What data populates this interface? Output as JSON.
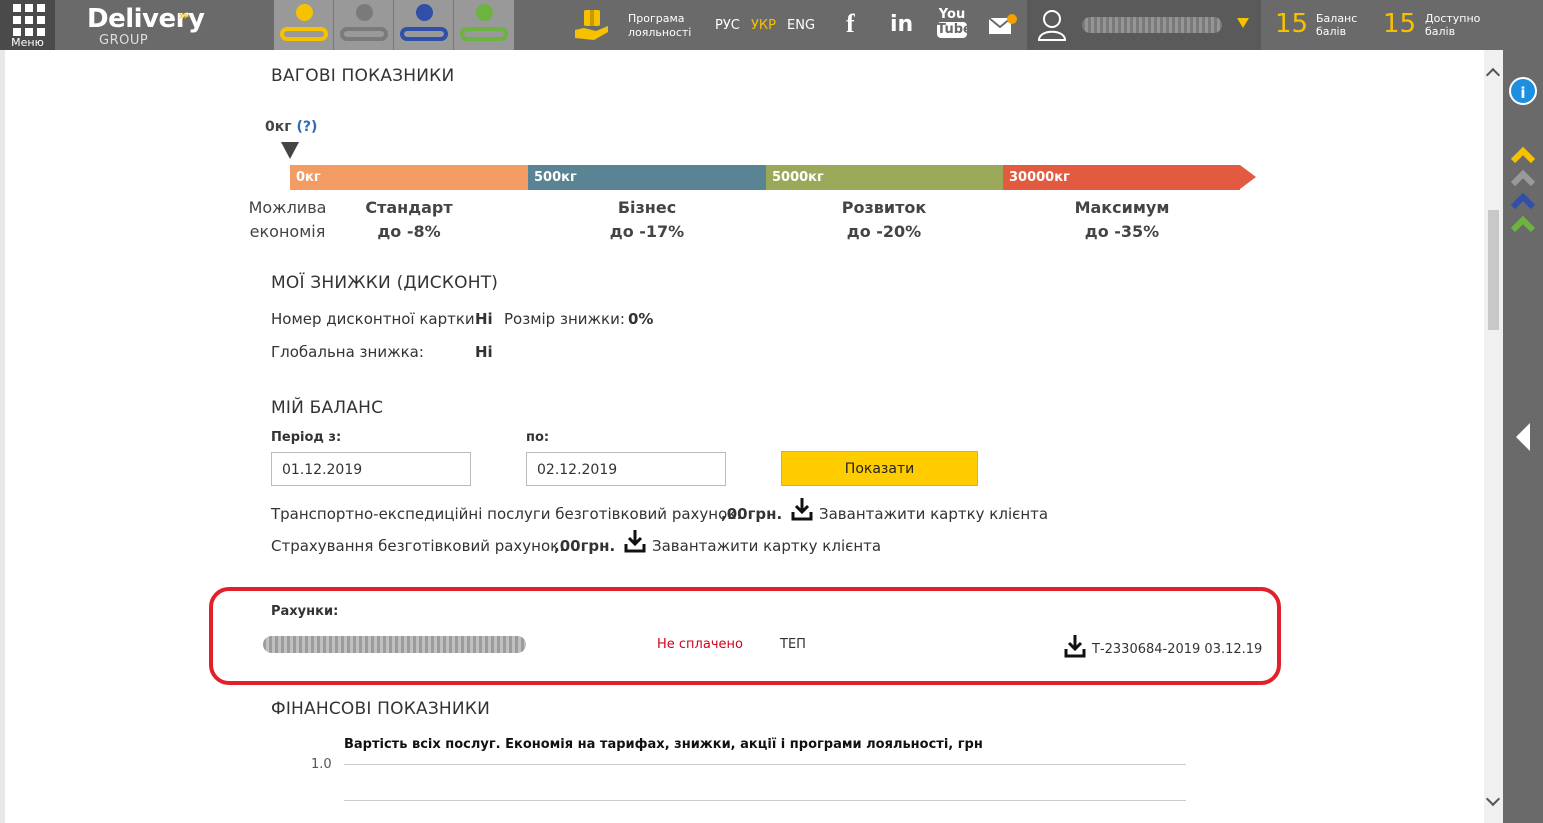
{
  "topbar": {
    "menu_label": "Меню",
    "logo_main": "Delivery",
    "logo_sub": "GROUP",
    "loyalty_line1": "Програма",
    "loyalty_line2": "лояльності",
    "languages": [
      "РУС",
      "УКР",
      "ENG"
    ],
    "active_language": "УКР",
    "social": [
      "facebook",
      "linkedin",
      "youtube",
      "mail"
    ],
    "youtube_line1": "You",
    "youtube_line2": "Tube",
    "balance_points": "15",
    "balance_label_1": "Баланс",
    "balance_label_2": "балів",
    "available_points": "15",
    "available_label_1": "Доступно",
    "available_label_2": "балів",
    "colors": {
      "bar_bg": "#6a6a6a",
      "accent": "#f6c200"
    }
  },
  "weights": {
    "title": "ВАГОВІ ПОКАЗНИКИ",
    "current": "0кг",
    "help": "(?)",
    "segments": [
      {
        "label": "0кг",
        "color": "#f29b62"
      },
      {
        "label": "500кг",
        "color": "#5a8494"
      },
      {
        "label": "5000кг",
        "color": "#9aa85a"
      },
      {
        "label": "30000кг",
        "color": "#e25b41"
      }
    ],
    "tiers": [
      {
        "name": "Можлива",
        "value": "економія"
      },
      {
        "name": "Стандарт",
        "value": "до -8%"
      },
      {
        "name": "Бізнес",
        "value": "до -17%"
      },
      {
        "name": "Розвиток",
        "value": "до -20%"
      },
      {
        "name": "Максимум",
        "value": "до -35%"
      }
    ]
  },
  "discounts": {
    "title": "МОЇ ЗНИЖКИ (ДИСКОНТ)",
    "card_label": "Номер дисконтної картки:",
    "card_value": "Ні",
    "size_label": "Розмір знижки:",
    "size_value": "0%",
    "global_label": "Глобальна знижка:",
    "global_value": "Ні"
  },
  "balance": {
    "title": "МІЙ БАЛАНС",
    "period_from_label": "Період з:",
    "period_from_value": "01.12.2019",
    "period_to_label": "по:",
    "period_to_value": "02.12.2019",
    "show_button": "Показати",
    "transport_label": "Транспортно-експедиційні послуги безготівковий рахунок:",
    "transport_value": ",00грн.",
    "insurance_label": "Страхування безготівковий рахунок:",
    "insurance_value": ",00грн.",
    "download_label": "Завантажити картку клієнта"
  },
  "invoices": {
    "title": "Рахунки:",
    "status": "Не сплачено",
    "type": "ТЕП",
    "document": "Т-2330684-2019 03.12.19",
    "status_color": "#d0021b"
  },
  "finance": {
    "title": "ФІНАНСОВІ ПОКАЗНИКИ",
    "chart_title": "Вартість всіх послуг. Економія на тарифах, знижки, акції і програми лояльності, грн",
    "y_tick": "1.0"
  }
}
